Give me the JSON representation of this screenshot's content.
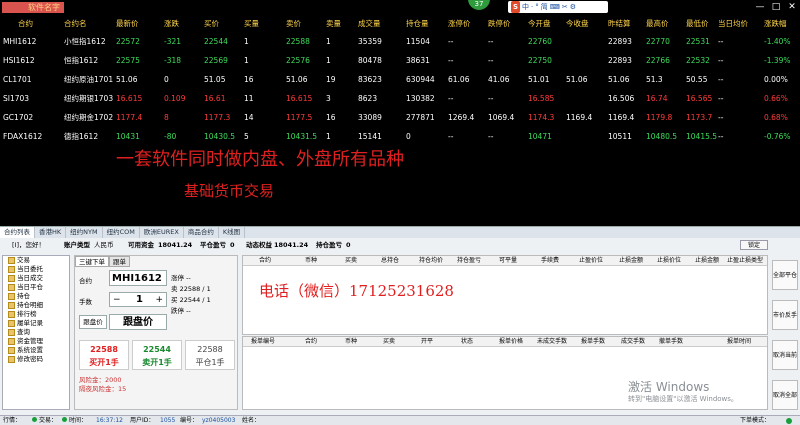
{
  "window": {
    "title": "软件名字",
    "badge": "37",
    "ime": [
      "中",
      "·",
      "°",
      "简",
      "⌨",
      "✂",
      "⚙"
    ],
    "ime_brand": "S"
  },
  "quotes": {
    "headers": [
      "合约",
      "合约名",
      "最新价",
      "涨跌",
      "买价",
      "买量",
      "卖价",
      "卖量",
      "成交量",
      "持仓量",
      "涨停价",
      "跌停价",
      "今开盘",
      "今收盘",
      "昨结算",
      "最高价",
      "最低价",
      "当日均价",
      "涨跌幅"
    ],
    "rows": [
      {
        "code": "MHI1612",
        "name": "小恒指1612",
        "last": "22572",
        "chg": "-321",
        "bid": "22544",
        "bidvol": "1",
        "ask": "22588",
        "askvol": "1",
        "vol": "35359",
        "oi": "11504",
        "up": "--",
        "down": "--",
        "open": "22760",
        "close": "",
        "prev": "22893",
        "high": "22770",
        "low": "22531",
        "avg": "--",
        "pct": "-1.40%",
        "dir": "down"
      },
      {
        "code": "HSI1612",
        "name": "恒指1612",
        "last": "22575",
        "chg": "-318",
        "bid": "22569",
        "bidvol": "1",
        "ask": "22576",
        "askvol": "1",
        "vol": "80478",
        "oi": "38631",
        "up": "--",
        "down": "--",
        "open": "22750",
        "close": "",
        "prev": "22893",
        "high": "22766",
        "low": "22532",
        "avg": "--",
        "pct": "-1.39%",
        "dir": "down"
      },
      {
        "code": "CL1701",
        "name": "纽约原油1701",
        "last": "51.06",
        "chg": "0",
        "bid": "51.05",
        "bidvol": "16",
        "ask": "51.06",
        "askvol": "19",
        "vol": "83623",
        "oi": "630944",
        "up": "61.06",
        "down": "41.06",
        "open": "51.01",
        "close": "51.06",
        "prev": "51.06",
        "high": "51.3",
        "low": "50.55",
        "avg": "--",
        "pct": "0.00%",
        "dir": "flat"
      },
      {
        "code": "SI1703",
        "name": "纽约期银1703",
        "last": "16.615",
        "chg": "0.109",
        "bid": "16.61",
        "bidvol": "11",
        "ask": "16.615",
        "askvol": "3",
        "vol": "8623",
        "oi": "130382",
        "up": "--",
        "down": "--",
        "open": "16.585",
        "close": "",
        "prev": "16.506",
        "high": "16.74",
        "low": "16.565",
        "avg": "--",
        "pct": "0.66%",
        "dir": "up"
      },
      {
        "code": "GC1702",
        "name": "纽约期金1702",
        "last": "1177.4",
        "chg": "8",
        "bid": "1177.3",
        "bidvol": "14",
        "ask": "1177.5",
        "askvol": "16",
        "vol": "33089",
        "oi": "277871",
        "up": "1269.4",
        "down": "1069.4",
        "open": "1174.3",
        "close": "1169.4",
        "prev": "1169.4",
        "high": "1179.8",
        "low": "1173.7",
        "avg": "--",
        "pct": "0.68%",
        "dir": "up"
      },
      {
        "code": "FDAX1612",
        "name": "德指1612",
        "last": "10431",
        "chg": "-80",
        "bid": "10430.5",
        "bidvol": "5",
        "ask": "10431.5",
        "askvol": "1",
        "vol": "15141",
        "oi": "0",
        "up": "--",
        "down": "--",
        "open": "10471",
        "close": "",
        "prev": "10511",
        "high": "10480.5",
        "low": "10415.5",
        "avg": "--",
        "pct": "-0.76%",
        "dir": "down"
      }
    ]
  },
  "banner": {
    "line1": "一套软件同时做内盘、外盘所有品种",
    "line2": "基础货币交易"
  },
  "tabs": [
    "合约列表",
    "香港HK",
    "纽约NYM",
    "纽约COM",
    "欧洲EUREX",
    "商品合约",
    "K线图"
  ],
  "account": {
    "greeting": "[I]，您好！",
    "type_label": "账户类型",
    "currency": "人民币",
    "avail_label": "可用资金",
    "avail": "18041.24",
    "close_pnl_label": "平仓盈亏",
    "close_pnl": "0",
    "equity_label": "动态权益",
    "equity": "18041.24",
    "pos_pnl_label": "持仓盈亏",
    "pos_pnl": "0",
    "lock": "锁定"
  },
  "nav": [
    "交易",
    "当日委托",
    "当日成交",
    "当日平仓",
    "持仓",
    "持仓明细",
    "排行榜",
    "履单记录",
    "查询",
    "资金管理",
    "系统设置",
    "修改密码"
  ],
  "order": {
    "tabs": [
      "三键下单",
      "跟单"
    ],
    "contract_label": "合约",
    "contract": "MHI1612",
    "qty_label": "手数",
    "qty": "1",
    "minus": "−",
    "plus": "+",
    "limit_up": "涨停 --",
    "ask_info": "卖  22588 / 1",
    "bid_info": "买  22544 / 1",
    "limit_down": "跌停 --",
    "follow_btn": "跟盘价",
    "price": "跟盘价",
    "buy_price": "22588",
    "buy_label": "买开1手",
    "sell_price": "22544",
    "sell_label": "卖开1手",
    "close_price": "22588",
    "close_label": "平仓1手",
    "risk1": "风险金：2000",
    "risk2": "隔夜风险金：15"
  },
  "positions": {
    "headers": [
      "合约",
      "币种",
      "买卖",
      "总持仓",
      "持仓均价",
      "持仓盈亏",
      "可平量",
      "手续费",
      "止盈价位",
      "止损金额",
      "止损价位",
      "止损金额",
      "止盈止损类型"
    ]
  },
  "phone": "电话（微信）17125231628",
  "orders": {
    "headers": [
      "报单编号",
      "合约",
      "币种",
      "买卖",
      "开平",
      "状态",
      "报单价格",
      "未成交手数",
      "报单手数",
      "成交手数",
      "撤单手数",
      "报单时间"
    ]
  },
  "right_buttons": [
    "全部平仓",
    "市价反手",
    "取消当前",
    "取消全部"
  ],
  "watermark": {
    "line1": "激活 Windows",
    "line2": "转到\"电脑设置\"以激活 Windows。"
  },
  "status": {
    "label": "行情：",
    "trade": "交易：",
    "time_label": "时间：",
    "time": "16:37:12",
    "user_label": "用户ID：",
    "user": "1055",
    "code_label": "编号：",
    "code": "yz0405003",
    "name_label": "姓名：",
    "name": "",
    "mode": "下单模式："
  },
  "colors": {
    "up": "#ff3b3b",
    "down": "#3ddc5a",
    "accent": "#ffd54a"
  }
}
